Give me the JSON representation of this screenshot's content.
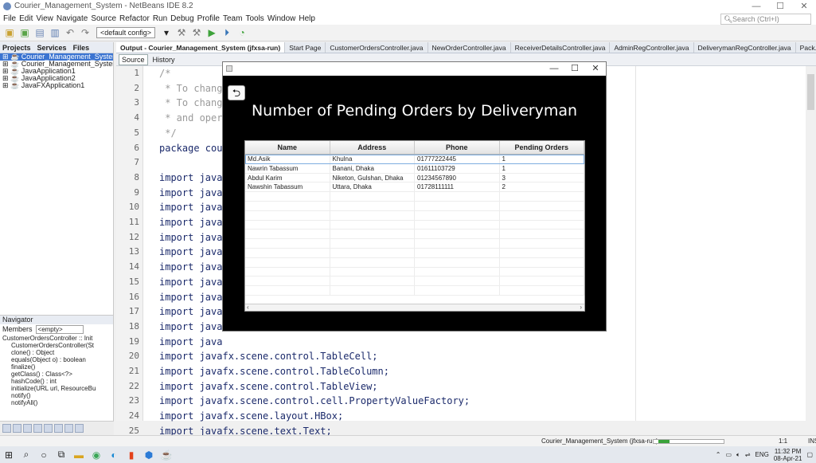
{
  "window": {
    "title": "Courier_Management_System - NetBeans IDE 8.2",
    "controls": [
      "—",
      "☐",
      "✕"
    ]
  },
  "menu": [
    "File",
    "Edit",
    "View",
    "Navigate",
    "Source",
    "Refactor",
    "Run",
    "Debug",
    "Profile",
    "Team",
    "Tools",
    "Window",
    "Help"
  ],
  "search_placeholder": "Search (Ctrl+I)",
  "config_select": "<default config>",
  "projects_panel": {
    "tabs": [
      "Projects",
      "Services",
      "Files"
    ],
    "items": [
      "Courier_Management_System",
      "Courier_Management_System",
      "JavaApplication1",
      "JavaApplication2",
      "JavaFXApplication1"
    ]
  },
  "navigator": {
    "title": "Navigator",
    "members_label": "Members",
    "members_select": "<empty>",
    "items": [
      "CustomerOrdersController :: Init",
      "CustomerOrdersController(St",
      "clone() : Object",
      "equals(Object o) : boolean",
      "finalize()",
      "getClass() : Class<?>",
      "hashCode() : int",
      "initialize(URL url, ResourceBu",
      "notify()",
      "notifyAll()"
    ]
  },
  "editor_tabs": [
    "Output - Courier_Management_System (jfxsa-run)",
    "Start Page",
    "CustomerOrdersController.java",
    "NewOrderController.java",
    "ReceiverDetailsController.java",
    "AdminRegController.java",
    "DeliverymanRegController.java",
    "Pack..."
  ],
  "editor_sub": {
    "source": "Source",
    "history": "History"
  },
  "code_lines": [
    {
      "n": "1",
      "t": "/*",
      "cm": true
    },
    {
      "n": "2",
      "t": " * To chang                                            ies.",
      "cm": true
    },
    {
      "n": "3",
      "t": " * To chang",
      "cm": true
    },
    {
      "n": "4",
      "t": " * and oper",
      "cm": true
    },
    {
      "n": "5",
      "t": " */",
      "cm": true
    },
    {
      "n": "6",
      "t": "package cou",
      "cm": false
    },
    {
      "n": "7",
      "t": "",
      "cm": false
    },
    {
      "n": "8",
      "t": "import java",
      "cm": false
    },
    {
      "n": "9",
      "t": "import java",
      "cm": false
    },
    {
      "n": "10",
      "t": "import java",
      "cm": false
    },
    {
      "n": "11",
      "t": "import java",
      "cm": false
    },
    {
      "n": "12",
      "t": "import java",
      "cm": false
    },
    {
      "n": "13",
      "t": "import java",
      "cm": false
    },
    {
      "n": "14",
      "t": "import java",
      "cm": false
    },
    {
      "n": "15",
      "t": "import java",
      "cm": false
    },
    {
      "n": "16",
      "t": "import java",
      "cm": false
    },
    {
      "n": "17",
      "t": "import java",
      "cm": false
    },
    {
      "n": "18",
      "t": "import java",
      "cm": false
    },
    {
      "n": "19",
      "t": "import java",
      "cm": false
    },
    {
      "n": "20",
      "t": "import javafx.scene.control.TableCell;",
      "cm": false
    },
    {
      "n": "21",
      "t": "import javafx.scene.control.TableColumn;",
      "cm": false
    },
    {
      "n": "22",
      "t": "import javafx.scene.control.TableView;",
      "cm": false
    },
    {
      "n": "23",
      "t": "import javafx.scene.control.cell.PropertyValueFactory;",
      "cm": false
    },
    {
      "n": "24",
      "t": "import javafx.scene.layout.HBox;",
      "cm": false
    },
    {
      "n": "25",
      "t": "import javafx.scene.text.Text;",
      "cm": false
    }
  ],
  "dialog": {
    "controls": [
      "—",
      "☐",
      "✕"
    ],
    "back_glyph": "⮌",
    "heading": "Number of Pending Orders by Deliveryman",
    "columns": [
      "Name",
      "Address",
      "Phone",
      "Pending Orders"
    ],
    "rows": [
      [
        "Md.Asik",
        "Khulna",
        "01777222445",
        "1"
      ],
      [
        "Nawrin Tabassum",
        "Banani, Dhaka",
        "01611103729",
        "1"
      ],
      [
        "Abdul Karim",
        "Niketon, Gulshan, Dhaka",
        "01234567890",
        "3"
      ],
      [
        "Nawshin Tabassum",
        "Uttara, Dhaka",
        "01728111111",
        "2"
      ]
    ]
  },
  "status": {
    "run_label": "Courier_Management_System (jfxsa-run)",
    "position": "1:1",
    "mode": "INS"
  },
  "tray": {
    "lang": "ENG",
    "time": "11:32 PM",
    "date": "08-Apr-21"
  }
}
